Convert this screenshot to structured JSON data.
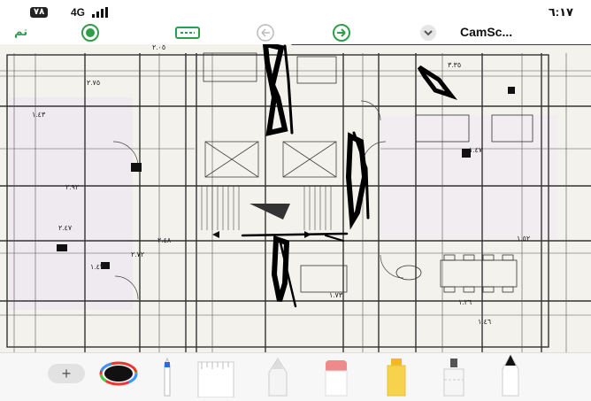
{
  "status_bar": {
    "battery": "٧٨",
    "network": "4G",
    "time": "٦:١٧"
  },
  "toolbar": {
    "done_label": "تم",
    "title": "CamSc...",
    "icons": [
      "pen-circle-icon",
      "scan-icon",
      "undo-icon",
      "redo-icon",
      "chevron-down-icon"
    ]
  },
  "document": {
    "labels": [
      "٢.٠٥",
      "٣.٣٥",
      "٢.٧٥",
      "١.٤٣",
      "١.٤٧",
      "٢.٩٢",
      "٢.٤٧",
      "٢.٤٨",
      "١.٥٢",
      "٢.٧٢",
      "١.٤٣",
      "١.٧٣",
      "١.٢٦",
      "١.٤٦"
    ]
  },
  "tools": {
    "add_label": "+",
    "items": [
      "plus-button",
      "color-picker",
      "pen-tool",
      "ruler-tool",
      "marker-tool",
      "eraser-tool",
      "highlighter-tool",
      "lasso-tool",
      "pencil-tool"
    ]
  },
  "colors": {
    "accent": "#2e9e4a",
    "ink": "#111111"
  }
}
